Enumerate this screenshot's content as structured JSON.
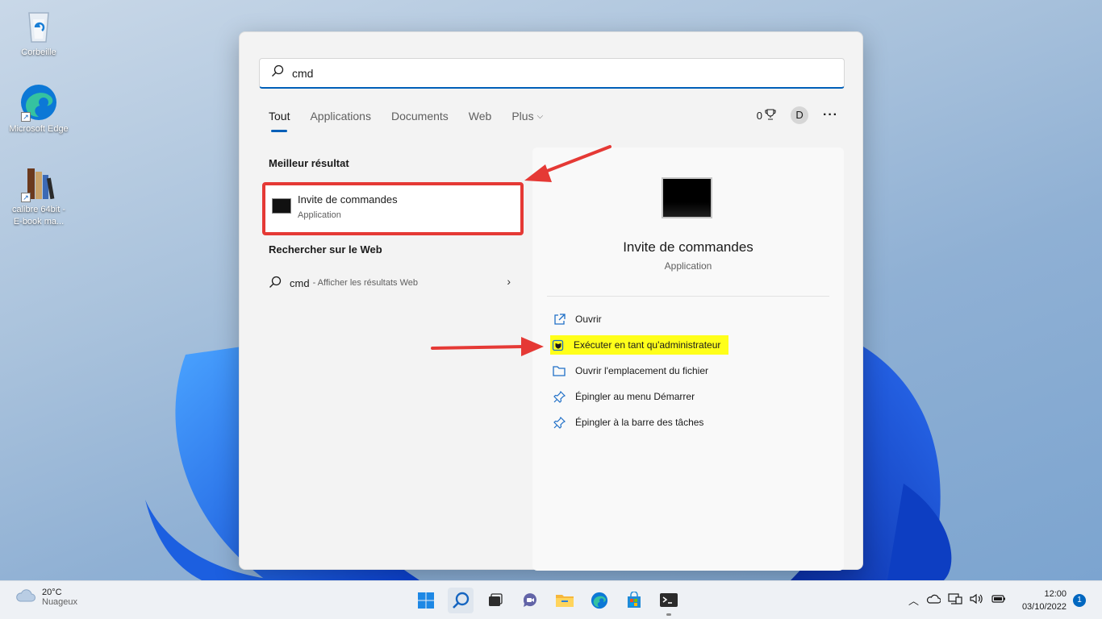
{
  "desktop": {
    "icons": [
      {
        "label": "Corbeille"
      },
      {
        "label": "Microsoft Edge"
      },
      {
        "label_line1": "calibre 64bit -",
        "label_line2": "E-book ma..."
      }
    ]
  },
  "search": {
    "query": "cmd",
    "tabs": [
      "Tout",
      "Applications",
      "Documents",
      "Web",
      "Plus"
    ],
    "rewards_count": "0",
    "avatar_letter": "D",
    "more": "···"
  },
  "results": {
    "best_title": "Meilleur résultat",
    "best_name": "Invite de commandes",
    "best_type": "Application",
    "web_title": "Rechercher sur le Web",
    "web_query": "cmd",
    "web_suffix": "- Afficher les résultats Web"
  },
  "detail": {
    "name": "Invite de commandes",
    "type": "Application",
    "actions": [
      {
        "label": "Ouvrir",
        "icon": "open-icon"
      },
      {
        "label": "Exécuter en tant qu'administrateur",
        "icon": "shield-icon",
        "highlighted": true
      },
      {
        "label": "Ouvrir l'emplacement du fichier",
        "icon": "folder-icon"
      },
      {
        "label": "Épingler au menu Démarrer",
        "icon": "pin-icon"
      },
      {
        "label": "Épingler à la barre des tâches",
        "icon": "pin-icon"
      }
    ]
  },
  "taskbar": {
    "weather_temp": "20°C",
    "weather_desc": "Nuageux",
    "time": "12:00",
    "date": "03/10/2022",
    "notification_count": "1"
  },
  "colors": {
    "accent": "#005fb8",
    "annotation_red": "#e53935",
    "highlight_yellow": "#ffff1a"
  }
}
